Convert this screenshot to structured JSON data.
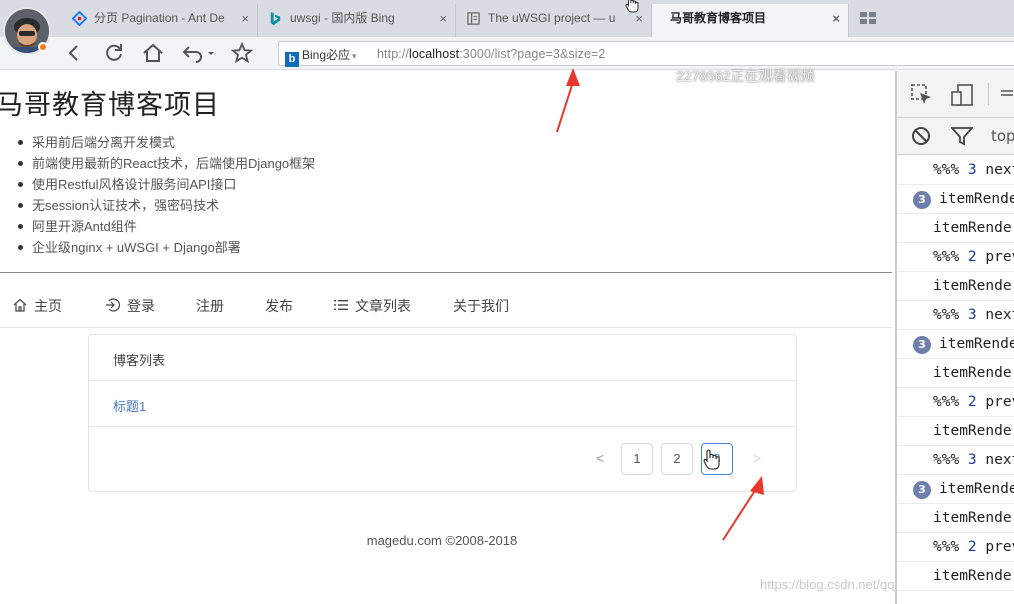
{
  "browser": {
    "tabs": [
      {
        "label": "分页 Pagination - Ant De",
        "icon": "ant-design-icon",
        "close": "×"
      },
      {
        "label": "uwsgi - 国内版 Bing",
        "icon": "bing-icon",
        "close": "×"
      },
      {
        "label": "The uWSGI project — u",
        "icon": "document-icon",
        "close": "×"
      },
      {
        "label": "马哥教育博客项目",
        "icon": "",
        "close": "×"
      }
    ],
    "search_engine": "Bing必应",
    "search_engine_letter": "b",
    "engine_caret": "▾",
    "url_prefix": "http://",
    "url_host": "localhost",
    "url_rest": ":3000/list?page=3&size=2"
  },
  "site": {
    "title": "马哥教育博客项目",
    "features": [
      "采用前后端分离开发模式",
      "前端使用最新的React技术，后端使用Django框架",
      "使用Restful风格设计服务间API接口",
      "无session认证技术，强密码技术",
      "阿里开源Antd组件",
      "企业级nginx + uWSGI + Django部署"
    ],
    "menu": [
      {
        "label": "主页",
        "icon": "home-icon"
      },
      {
        "label": "登录",
        "icon": "login-icon"
      },
      {
        "label": "注册",
        "icon": ""
      },
      {
        "label": "发布",
        "icon": ""
      },
      {
        "label": "文章列表",
        "icon": "list-icon"
      },
      {
        "label": "关于我们",
        "icon": ""
      }
    ],
    "list": {
      "header": "博客列表",
      "items": [
        "标题1"
      ]
    },
    "pagination": {
      "prev": "<",
      "pages": [
        "1",
        "2",
        "3"
      ],
      "current": "3",
      "next": ">"
    },
    "footer": "magedu.com ©2008-2018"
  },
  "watermarks": {
    "viewer": "2278562正在观看视频",
    "csdn": "https://blog.csdn.net/qq_"
  },
  "devtools": {
    "context": "top",
    "logs": [
      {
        "badge": "",
        "prefix": "%%% ",
        "num": "3",
        "suffix": " next"
      },
      {
        "badge": "3",
        "text": "itemRender"
      },
      {
        "badge": "",
        "text": "itemRender"
      },
      {
        "badge": "",
        "prefix": "%%% ",
        "num": "2",
        "suffix": " prev"
      },
      {
        "badge": "",
        "text": "itemRender"
      },
      {
        "badge": "",
        "prefix": "%%% ",
        "num": "3",
        "suffix": " next"
      },
      {
        "badge": "3",
        "text": "itemRender"
      },
      {
        "badge": "",
        "text": "itemRender"
      },
      {
        "badge": "",
        "prefix": "%%% ",
        "num": "2",
        "suffix": " prev"
      },
      {
        "badge": "",
        "text": "itemRender"
      },
      {
        "badge": "",
        "prefix": "%%% ",
        "num": "3",
        "suffix": " next"
      },
      {
        "badge": "3",
        "text": "itemRender"
      },
      {
        "badge": "",
        "text": "itemRender"
      },
      {
        "badge": "",
        "prefix": "%%% ",
        "num": "2",
        "suffix": " prev"
      },
      {
        "badge": "",
        "text": "itemRender"
      }
    ]
  },
  "colors": {
    "accent": "#4a86d6",
    "link": "#4a78c9",
    "annotation_arrow": "#e8372c"
  }
}
